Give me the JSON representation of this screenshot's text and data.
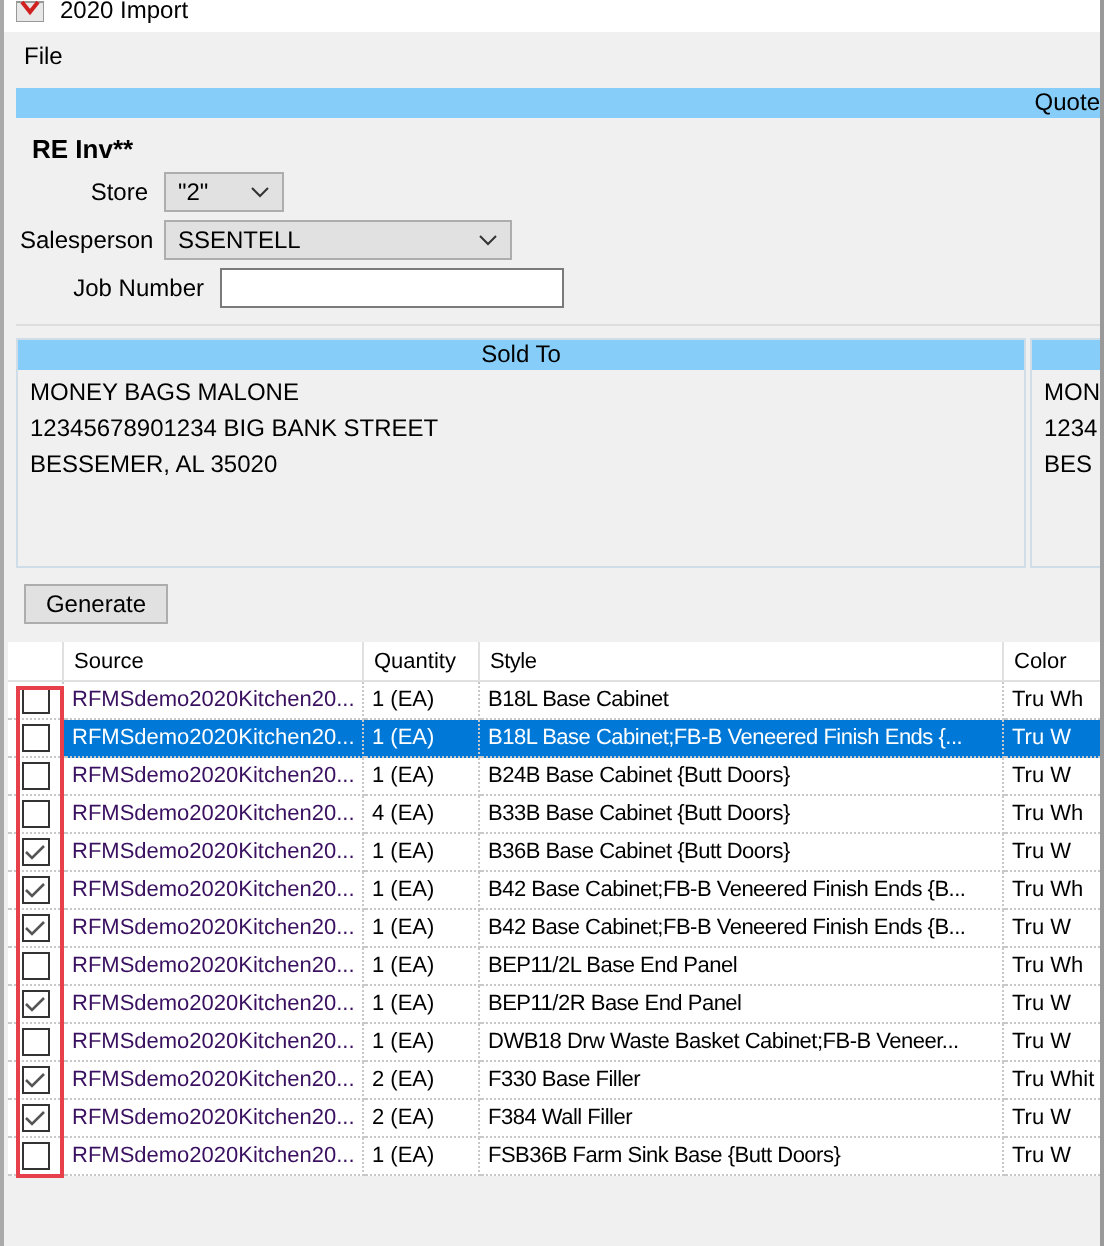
{
  "window": {
    "title": "2020 Import"
  },
  "menu": [
    "File"
  ],
  "quote": {
    "header": "Quote",
    "title": "RE Inv**",
    "store": {
      "label": "Store",
      "value": "\"2\""
    },
    "salesperson": {
      "label": "Salesperson",
      "value": "SSENTELL"
    },
    "job_number": {
      "label": "Job Number"
    }
  },
  "sold_to": {
    "header": "Sold To",
    "lines": [
      "MONEY BAGS MALONE",
      "12345678901234 BIG BANK STREET",
      "BESSEMER, AL 35020"
    ]
  },
  "second_panel": {
    "lines": [
      "MON",
      "1234",
      "BES"
    ]
  },
  "generate_button": "Generate",
  "table": {
    "columns": [
      "Source",
      "Quantity",
      "Style",
      "Color"
    ],
    "rows": [
      {
        "checked": false,
        "selected": false,
        "cells": [
          "RFMSdemo2020Kitchen20...",
          "1 (EA)",
          "B18L Base Cabinet",
          "Tru Wh"
        ]
      },
      {
        "checked": false,
        "selected": true,
        "cells": [
          "RFMSdemo2020Kitchen20...",
          "1 (EA)",
          "B18L Base Cabinet;FB-B Veneered Finish Ends {...",
          "Tru W"
        ]
      },
      {
        "checked": false,
        "selected": false,
        "cells": [
          "RFMSdemo2020Kitchen20...",
          "1 (EA)",
          "B24B Base Cabinet {Butt Doors}",
          "Tru W"
        ]
      },
      {
        "checked": false,
        "selected": false,
        "cells": [
          "RFMSdemo2020Kitchen20...",
          "4 (EA)",
          "B33B Base Cabinet {Butt Doors}",
          "Tru Wh"
        ]
      },
      {
        "checked": true,
        "selected": false,
        "cells": [
          "RFMSdemo2020Kitchen20...",
          "1 (EA)",
          "B36B Base Cabinet {Butt Doors}",
          "Tru W"
        ]
      },
      {
        "checked": true,
        "selected": false,
        "cells": [
          "RFMSdemo2020Kitchen20...",
          "1 (EA)",
          "B42 Base Cabinet;FB-B Veneered Finish Ends {B...",
          "Tru Wh"
        ]
      },
      {
        "checked": true,
        "selected": false,
        "cells": [
          "RFMSdemo2020Kitchen20...",
          "1 (EA)",
          "B42 Base Cabinet;FB-B Veneered Finish Ends {B...",
          "Tru W"
        ]
      },
      {
        "checked": false,
        "selected": false,
        "cells": [
          "RFMSdemo2020Kitchen20...",
          "1 (EA)",
          "BEP11/2L Base End Panel",
          "Tru Wh"
        ]
      },
      {
        "checked": true,
        "selected": false,
        "cells": [
          "RFMSdemo2020Kitchen20...",
          "1 (EA)",
          "BEP11/2R Base End Panel",
          "Tru W"
        ]
      },
      {
        "checked": false,
        "selected": false,
        "cells": [
          "RFMSdemo2020Kitchen20...",
          "1 (EA)",
          "DWB18 Drw Waste Basket Cabinet;FB-B Veneer...",
          "Tru W"
        ]
      },
      {
        "checked": true,
        "selected": false,
        "cells": [
          "RFMSdemo2020Kitchen20...",
          "2 (EA)",
          "F330 Base Filler",
          "Tru Whit"
        ]
      },
      {
        "checked": true,
        "selected": false,
        "cells": [
          "RFMSdemo2020Kitchen20...",
          "2 (EA)",
          "F384 Wall Filler",
          "Tru W"
        ]
      },
      {
        "checked": false,
        "selected": false,
        "cells": [
          "RFMSdemo2020Kitchen20...",
          "1 (EA)",
          "FSB36B Farm Sink Base {Butt Doors}",
          "Tru W"
        ]
      }
    ]
  }
}
